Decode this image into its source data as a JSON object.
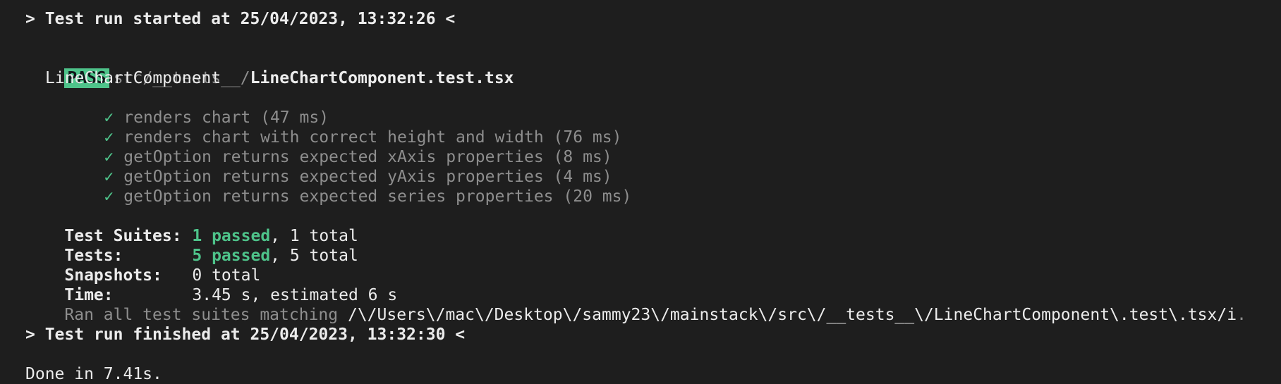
{
  "run_started": "> Test run started at 25/04/2023, 13:32:26 <",
  "suite": {
    "badge": "PASS",
    "path_prefix": "src/__tests__/",
    "file": "LineChartComponent.test.tsx",
    "describe": "LineChartComponent",
    "check_mark": "✓",
    "tests": [
      "renders chart (47 ms)",
      "renders chart with correct height and width (76 ms)",
      "getOption returns expected xAxis properties (8 ms)",
      "getOption returns expected yAxis properties (4 ms)",
      "getOption returns expected series properties (20 ms)"
    ]
  },
  "summary": {
    "suites_label": "Test Suites:",
    "suites_passed": "1 passed",
    "suites_total": ", 1 total",
    "tests_label": "Tests:",
    "tests_passed": "5 passed",
    "tests_total": ", 5 total",
    "snapshots_label": "Snapshots:",
    "snapshots_value": "0 total",
    "time_label": "Time:",
    "time_value": "3.45 s, estimated 6 s",
    "ran_prefix": "Ran all test suites matching ",
    "ran_pattern": "/\\/Users\\/mac\\/Desktop\\/sammy23\\/mainstack\\/src\\/__tests__\\/LineChartComponent\\.test\\.tsx/i",
    "ran_suffix": "."
  },
  "run_finished": "> Test run finished at 25/04/2023, 13:32:30 <",
  "done": "Done in 7.41s."
}
